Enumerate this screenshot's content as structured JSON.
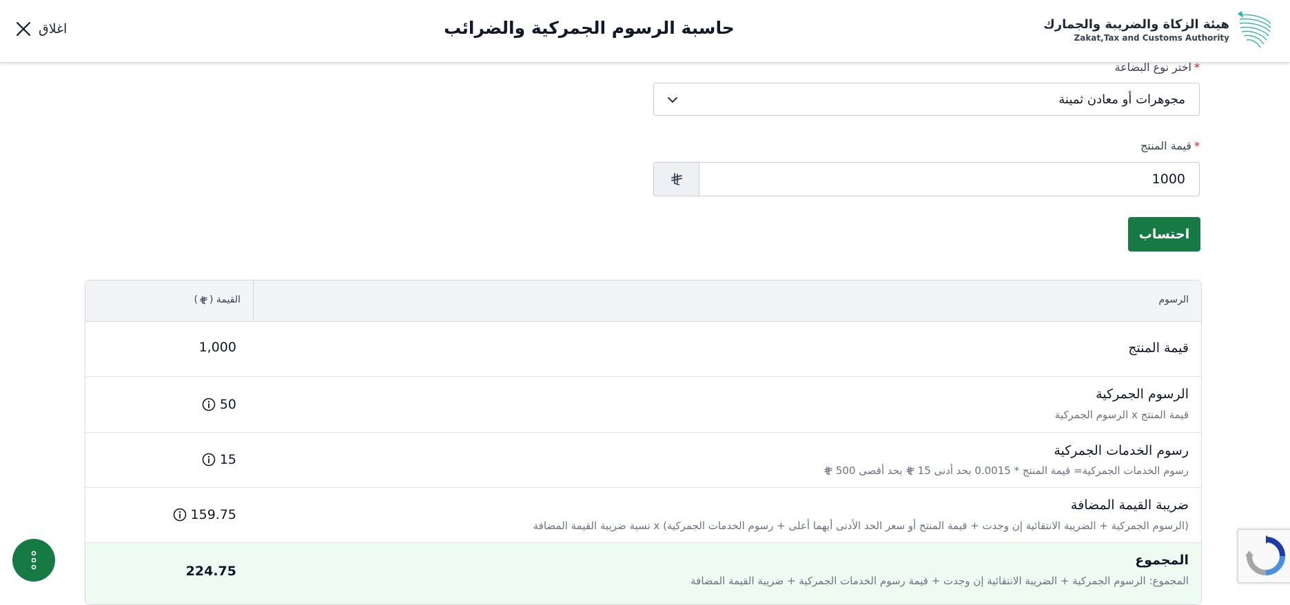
{
  "header": {
    "close_label": "اغلاق",
    "title": "حاسبة الرسوم الجمركية والضرائب",
    "logo_ar": "هيئة الزكاة والضريبة والجمارك",
    "logo_en": "Zakat,Tax and Customs Authority"
  },
  "form": {
    "goods_type_label": "اختر نوع البضاعة",
    "goods_type_value": "مجوهرات أو معادن ثمينة",
    "product_value_label": "قيمة المنتج",
    "product_value": "1000",
    "calculate_label": "احتساب"
  },
  "table": {
    "header_fees": "الرسوم",
    "header_value": "القيمة (",
    "header_value_close": ")",
    "rows": [
      {
        "title": "قيمة المنتج",
        "desc": "",
        "value": "1,000"
      },
      {
        "title": "الرسوم الجمركية",
        "desc": "قيمة المنتج x الرسوم الجمركية",
        "value": "50"
      },
      {
        "title": "رسوم الخدمات الجمركية",
        "desc_part1": "رسوم الخدمات الجمركية= قيمة المنتج * 0.0015 بحد أدنى 15",
        "desc_part2": "بحد أقصى 500",
        "value": "15"
      },
      {
        "title": "ضريبة القيمة المضافة",
        "desc": "(الرسوم الجمركية + الضريبة الانتقائية إن وجدت + قيمة المنتج أو سعر الحد الأدنى أيهما أعلى + رسوم الخدمات الجمركية) x نسبة ضريبة القيمة المضافة",
        "value": "159.75"
      },
      {
        "title": "المجموع",
        "desc": "المجموع: الرسوم الجمركية + الضريبة الانتقائية إن وجدت + قيمة رسوم الخدمات الجمركية + ضريبة القيمة المضافة",
        "value": "224.75"
      }
    ]
  },
  "colors": {
    "primary": "#167a45",
    "required": "#d11a1a",
    "total_bg": "#eefbf3"
  },
  "icons": [
    "close-icon",
    "chevron-down-icon",
    "riyal-icon",
    "info-icon",
    "more-vertical-icon",
    "recaptcha-icon",
    "zatca-logo"
  ]
}
